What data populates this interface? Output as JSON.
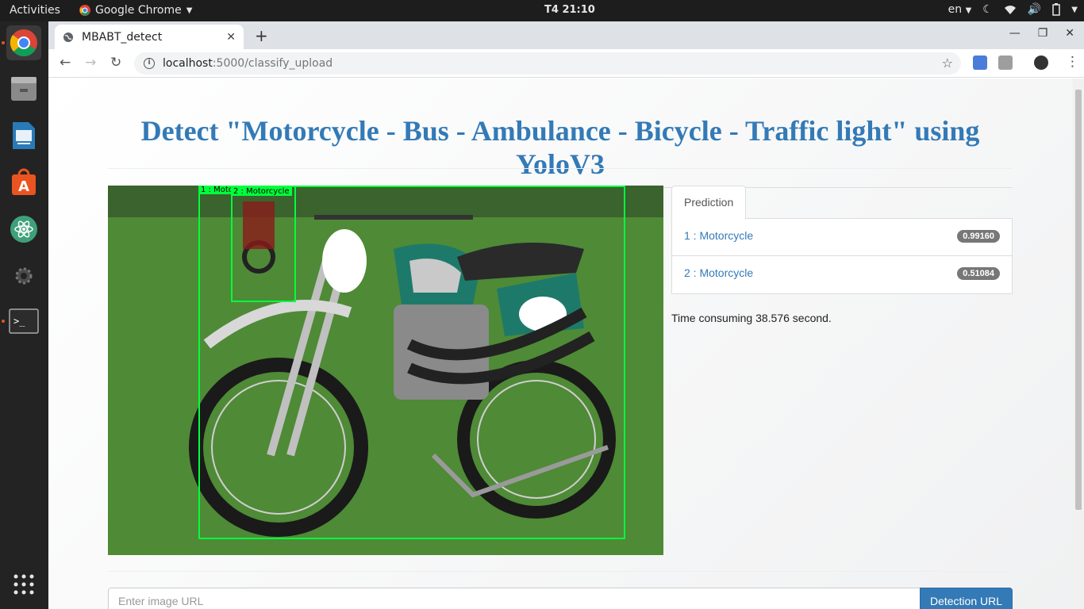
{
  "topbar": {
    "activities": "Activities",
    "app_name": "Google Chrome",
    "clock": "T4 21:10",
    "language": "en"
  },
  "dock": {
    "items": [
      "chrome-icon",
      "files-icon",
      "document-viewer-icon",
      "software-center-icon",
      "atom-icon",
      "settings-icon",
      "terminal-icon"
    ],
    "apps_grid": "show-applications-icon"
  },
  "browser": {
    "tab_title": "MBABT_detect",
    "url_host": "localhost",
    "url_path": ":5000/classify_upload"
  },
  "page": {
    "heading": "Detect \"Motorcycle - Bus - Ambulance - Bicycle - Traffic light\" using YoloV3",
    "image": {
      "description_icon": "motorcycle-photo",
      "boxes": [
        {
          "label": "1 : Moto..."
        },
        {
          "label": "2 : Motorcycle"
        }
      ]
    },
    "prediction_tab": "Prediction",
    "predictions": [
      {
        "label": "1 : Motorcycle",
        "score": "0.99160"
      },
      {
        "label": "2 : Motorcycle",
        "score": "0.51084"
      }
    ],
    "time_text": "Time consuming 38.576 second.",
    "url_placeholder": "Enter image URL",
    "detect_button": "Detection URL"
  },
  "colors": {
    "accent": "#337ab7",
    "bbox": "#00ff3c",
    "badge": "#777777"
  }
}
